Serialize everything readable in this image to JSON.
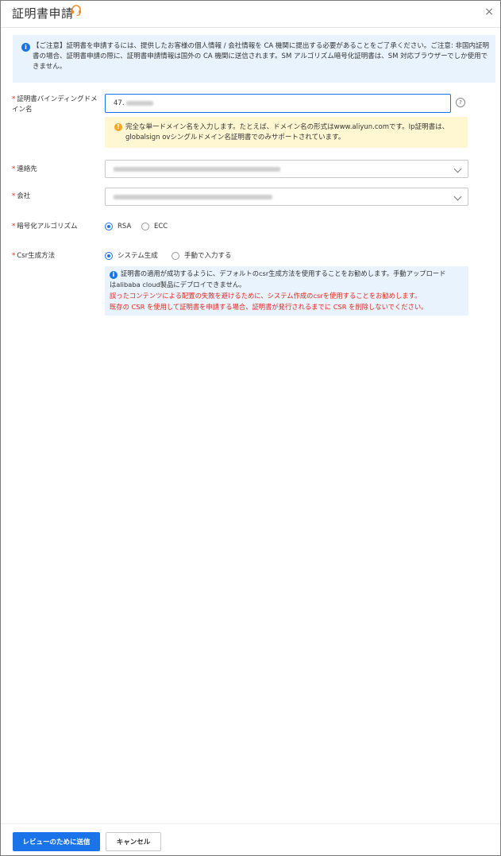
{
  "dialog": {
    "title": "証明書申請",
    "close_glyph": "×"
  },
  "notice": {
    "icon": "info-icon",
    "text": "【ご注意】証明書を申請するには、提供したお客様の個人情報 / 会社情報を CA 機関に提出する必要があることをご了承ください。ご注意: 非国内証明書の場合、証明書申請の際に、証明書申請情報は国外の CA 機関に送信されます。SM アルゴリズム暗号化証明書は、SM 対応ブラウザーでしか使用できません。"
  },
  "form": {
    "domain": {
      "required": "*",
      "label": "証明書バインディングドメイン名",
      "value": "47.",
      "help_glyph": "?",
      "hint": "完全な単一ドメイン名を入力します。たとえば、ドメイン名の形式はwww.aliyun.comです。Ip証明書は、globalsign ovシングルドメイン名証明書でのみサポートされています。"
    },
    "contact": {
      "required": "*",
      "label": "連絡先"
    },
    "company": {
      "required": "*",
      "label": "会社"
    },
    "algorithm": {
      "required": "*",
      "label": "暗号化アルゴリズム",
      "options": [
        {
          "label": "RSA",
          "selected": true
        },
        {
          "label": "ECC",
          "selected": false
        }
      ]
    },
    "csr": {
      "required": "*",
      "label": "Csr生成方法",
      "options": [
        {
          "label": "システム生成",
          "selected": true
        },
        {
          "label": "手動で入力する",
          "selected": false
        }
      ],
      "info_line1": "証明書の適用が成功するように、デフォルトのcsr生成方法を使用することをお勧めします。手動アップロード",
      "info_line2": "はalibaba cloud製品にデプロイできません。",
      "warn_line1": "誤ったコンテンツによる配置の失敗を避けるために、システム作成のcsrを使用することをお勧めします。",
      "warn_line2": "既存の CSR を使用して証明書を申請する場合、証明書が発行されるまでに CSR を削除しないでください。"
    }
  },
  "footer": {
    "submit_label": "レビューのために送信",
    "cancel_label": "キャンセル"
  },
  "colors": {
    "primary": "#1a73e8",
    "required": "#e0281d",
    "info_bg": "#e8f3fd",
    "warn_bg": "#fff7d1",
    "logo": "#f28c28"
  }
}
